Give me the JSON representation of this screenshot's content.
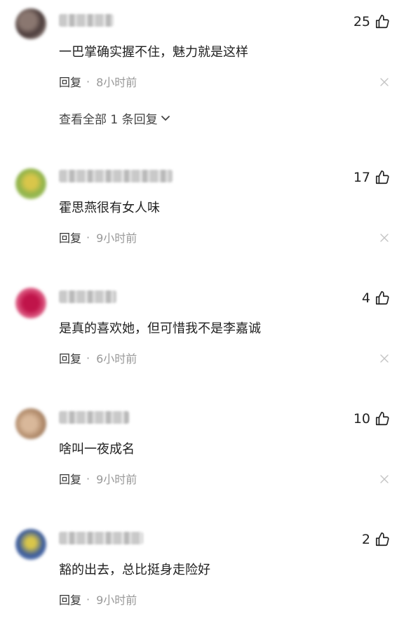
{
  "comments": [
    {
      "likes": "25",
      "text": "一巴掌确实握不住，魅力就是这样",
      "reply_label": "回复",
      "separator": "·",
      "time": "8小时前",
      "view_replies": "查看全部 1 条回复",
      "avatar_colors": [
        "#4a3b3a",
        "#8a7770",
        "#c9b9b0"
      ]
    },
    {
      "likes": "17",
      "text": "霍思燕很有女人味",
      "reply_label": "回复",
      "separator": "·",
      "time": "9小时前",
      "avatar_colors": [
        "#8fb34a",
        "#d9c64a",
        "#c7d98f"
      ]
    },
    {
      "likes": "4",
      "text": "是真的喜欢她，但可惜我不是李嘉诚",
      "reply_label": "回复",
      "separator": "·",
      "time": "6小时前",
      "avatar_colors": [
        "#c0144a",
        "#d9507a",
        "#f0b8c8"
      ]
    },
    {
      "likes": "10",
      "text": "啥叫一夜成名",
      "reply_label": "回复",
      "separator": "·",
      "time": "9小时前",
      "avatar_colors": [
        "#b08a6a",
        "#d9b89a",
        "#8a6a55"
      ]
    },
    {
      "likes": "2",
      "text": "豁的出去，总比挺身走险好",
      "reply_label": "回复",
      "separator": "·",
      "time": "9小时前",
      "avatar_colors": [
        "#3a5a9a",
        "#d9c64a",
        "#9ab0d9"
      ]
    }
  ]
}
